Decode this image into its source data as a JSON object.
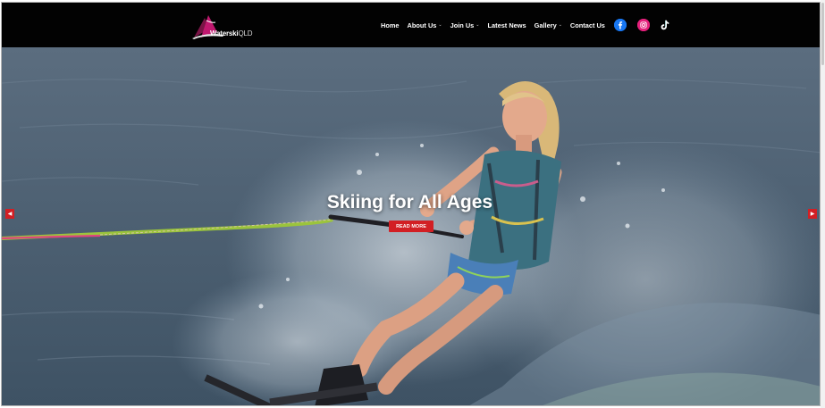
{
  "site": {
    "logo_name": "Waterski",
    "logo_region": "QLD"
  },
  "nav": {
    "items": [
      {
        "label": "Home",
        "dropdown": false
      },
      {
        "label": "About Us",
        "dropdown": true
      },
      {
        "label": "Join Us",
        "dropdown": true
      },
      {
        "label": "Latest News",
        "dropdown": false
      },
      {
        "label": "Gallery",
        "dropdown": true
      },
      {
        "label": "Contact Us",
        "dropdown": false
      }
    ],
    "caret": "⌄"
  },
  "social": [
    {
      "icon": "facebook-icon",
      "color": "#1877f2"
    },
    {
      "icon": "instagram-icon",
      "color": "#e4207b"
    },
    {
      "icon": "tiktok-icon",
      "color": "#ffffff"
    }
  ],
  "hero": {
    "title": "Skiing for All Ages",
    "button_label": "READ MORE",
    "prev_arrow": "◀",
    "next_arrow": "▶"
  },
  "colors": {
    "accent_red": "#d21f24",
    "logo_magenta": "#c0186f",
    "header_bg": "#020202"
  }
}
